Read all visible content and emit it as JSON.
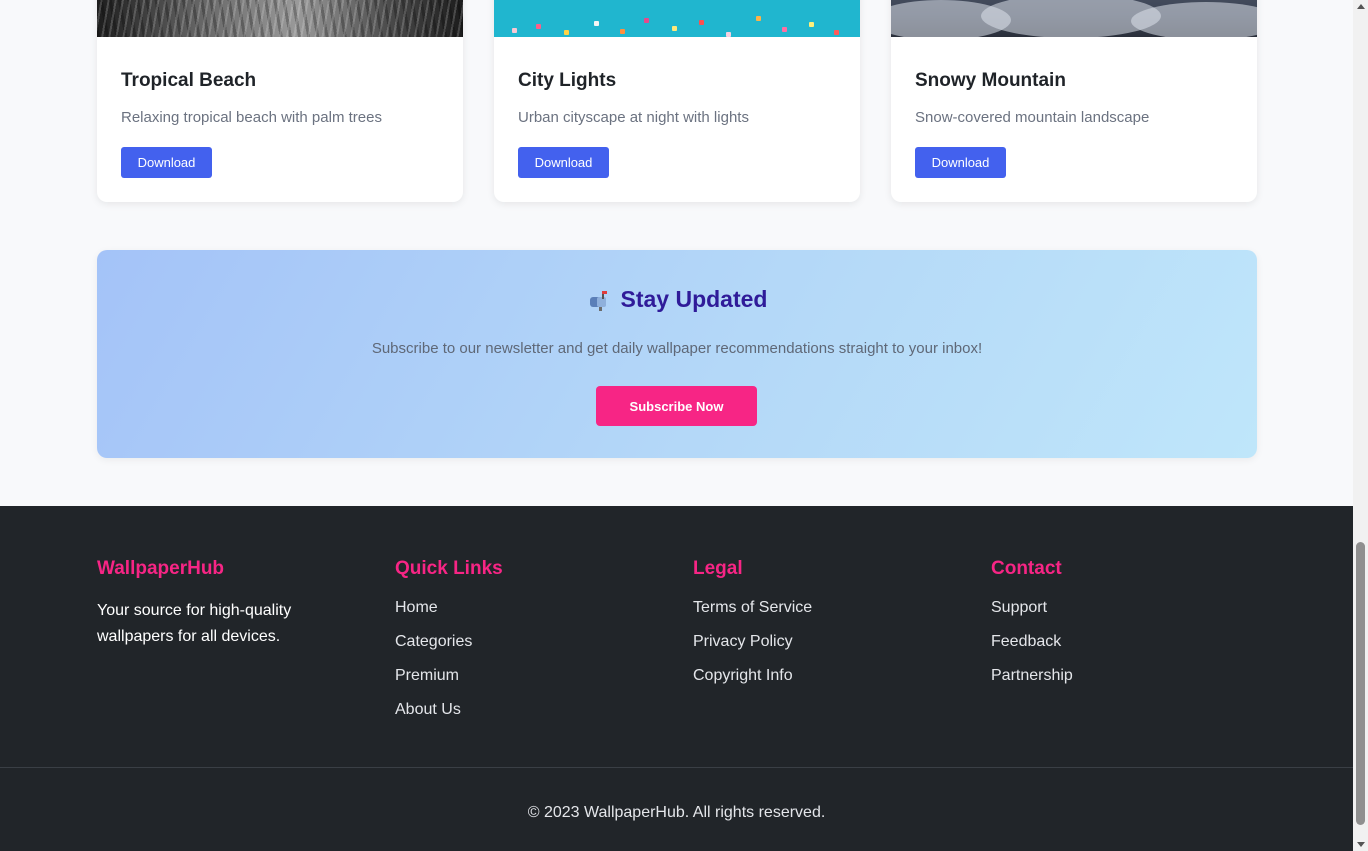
{
  "cards": [
    {
      "title": "Tropical Beach",
      "description": "Relaxing tropical beach with palm trees",
      "button": "Download"
    },
    {
      "title": "City Lights",
      "description": "Urban cityscape at night with lights",
      "button": "Download"
    },
    {
      "title": "Snowy Mountain",
      "description": "Snow-covered mountain landscape",
      "button": "Download"
    }
  ],
  "newsletter": {
    "icon": "mailbox-icon",
    "title": "Stay Updated",
    "text": "Subscribe to our newsletter and get daily wallpaper recommendations straight to your inbox!",
    "button": "Subscribe Now"
  },
  "footer": {
    "brand": {
      "title": "WallpaperHub",
      "text": "Your source for high-quality wallpapers for all devices."
    },
    "quick_links": {
      "title": "Quick Links",
      "items": [
        "Home",
        "Categories",
        "Premium",
        "About Us"
      ]
    },
    "legal": {
      "title": "Legal",
      "items": [
        "Terms of Service",
        "Privacy Policy",
        "Copyright Info"
      ]
    },
    "contact": {
      "title": "Contact",
      "items": [
        "Support",
        "Feedback",
        "Partnership"
      ]
    },
    "copyright": "© 2023 WallpaperHub. All rights reserved."
  },
  "colors": {
    "accent": "#f72585",
    "primary_button": "#4361ee",
    "newsletter_title": "#2f1b99",
    "footer_bg": "#212529"
  }
}
